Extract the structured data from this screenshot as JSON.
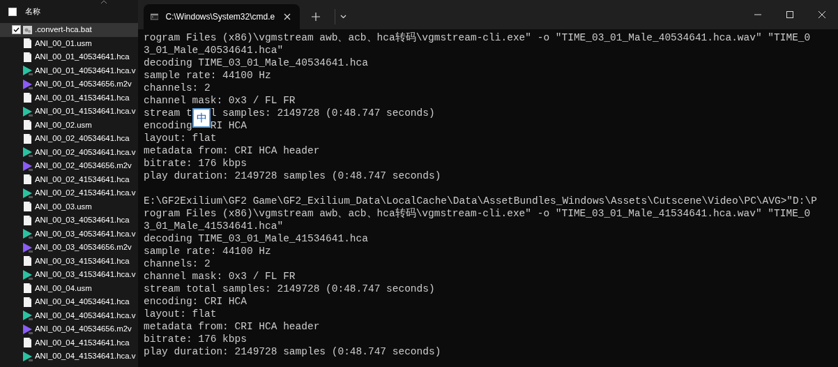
{
  "explorer": {
    "header": {
      "label": "名称",
      "checked": false
    },
    "items": [
      {
        "name": ".convert-hca.bat",
        "kind": "script",
        "selected": true,
        "checked": true
      },
      {
        "name": "ANI_00_01.usm",
        "kind": "file",
        "selected": false,
        "checked": false
      },
      {
        "name": "ANI_00_01_40534641.hca",
        "kind": "file",
        "selected": false,
        "checked": false
      },
      {
        "name": "ANI_00_01_40534641.hca.v",
        "kind": "audio",
        "selected": false,
        "checked": false
      },
      {
        "name": "ANI_00_01_40534656.m2v",
        "kind": "video",
        "selected": false,
        "checked": false
      },
      {
        "name": "ANI_00_01_41534641.hca",
        "kind": "file",
        "selected": false,
        "checked": false
      },
      {
        "name": "ANI_00_01_41534641.hca.v",
        "kind": "audio",
        "selected": false,
        "checked": false
      },
      {
        "name": "ANI_00_02.usm",
        "kind": "file",
        "selected": false,
        "checked": false
      },
      {
        "name": "ANI_00_02_40534641.hca",
        "kind": "file",
        "selected": false,
        "checked": false
      },
      {
        "name": "ANI_00_02_40534641.hca.v",
        "kind": "audio",
        "selected": false,
        "checked": false
      },
      {
        "name": "ANI_00_02_40534656.m2v",
        "kind": "video",
        "selected": false,
        "checked": false
      },
      {
        "name": "ANI_00_02_41534641.hca",
        "kind": "file",
        "selected": false,
        "checked": false
      },
      {
        "name": "ANI_00_02_41534641.hca.v",
        "kind": "audio",
        "selected": false,
        "checked": false
      },
      {
        "name": "ANI_00_03.usm",
        "kind": "file",
        "selected": false,
        "checked": false
      },
      {
        "name": "ANI_00_03_40534641.hca",
        "kind": "file",
        "selected": false,
        "checked": false
      },
      {
        "name": "ANI_00_03_40534641.hca.v",
        "kind": "audio",
        "selected": false,
        "checked": false
      },
      {
        "name": "ANI_00_03_40534656.m2v",
        "kind": "video",
        "selected": false,
        "checked": false
      },
      {
        "name": "ANI_00_03_41534641.hca",
        "kind": "file",
        "selected": false,
        "checked": false
      },
      {
        "name": "ANI_00_03_41534641.hca.v",
        "kind": "audio",
        "selected": false,
        "checked": false
      },
      {
        "name": "ANI_00_04.usm",
        "kind": "file",
        "selected": false,
        "checked": false
      },
      {
        "name": "ANI_00_04_40534641.hca",
        "kind": "file",
        "selected": false,
        "checked": false
      },
      {
        "name": "ANI_00_04_40534641.hca.v",
        "kind": "audio",
        "selected": false,
        "checked": false
      },
      {
        "name": "ANI_00_04_40534656.m2v",
        "kind": "video",
        "selected": false,
        "checked": false
      },
      {
        "name": "ANI_00_04_41534641.hca",
        "kind": "file",
        "selected": false,
        "checked": false
      },
      {
        "name": "ANI_00_04_41534641.hca.v",
        "kind": "audio",
        "selected": false,
        "checked": false
      }
    ]
  },
  "terminal": {
    "tab": {
      "title": "C:\\Windows\\System32\\cmd.e",
      "selected": true
    },
    "ime_indicator": "中",
    "blocks": [
      [
        {
          "kind": "text",
          "text": "rogram Files (x86)\\vgmstream awb、acb、hca转码\\vgmstream-cli.exe\" -o \"TIME_03_01_Male_40534641.hca.wav\" \"TIME_0"
        },
        {
          "kind": "text",
          "text": "3_01_Male_40534641.hca\""
        },
        {
          "kind": "text",
          "text": "decoding TIME_03_01_Male_40534641.hca"
        },
        {
          "kind": "text",
          "text": "sample rate: 44100 Hz"
        },
        {
          "kind": "text",
          "text": "channels: 2"
        },
        {
          "kind": "text",
          "text": "channel mask: 0x3 / FL FR"
        },
        {
          "kind": "covered",
          "parts": [
            "stream t",
            "l samples: 2149728 (0:48.747 seconds)"
          ]
        },
        {
          "kind": "covered",
          "parts": [
            "encoding",
            "RI HCA"
          ]
        },
        {
          "kind": "text",
          "text": "layout: flat"
        },
        {
          "kind": "text",
          "text": "metadata from: CRI HCA header"
        },
        {
          "kind": "text",
          "text": "bitrate: 176 kbps"
        },
        {
          "kind": "text",
          "text": "play duration: 2149728 samples (0:48.747 seconds)"
        }
      ],
      [
        {
          "kind": "text",
          "text": "E:\\GF2Exilium\\GF2 Game\\GF2_Exilium_Data\\LocalCache\\Data\\AssetBundles_Windows\\Assets\\Cutscene\\Video\\PC\\AVG>\"D:\\P"
        },
        {
          "kind": "text",
          "text": "rogram Files (x86)\\vgmstream awb、acb、hca转码\\vgmstream-cli.exe\" -o \"TIME_03_01_Male_41534641.hca.wav\" \"TIME_0"
        },
        {
          "kind": "text",
          "text": "3_01_Male_41534641.hca\""
        },
        {
          "kind": "text",
          "text": "decoding TIME_03_01_Male_41534641.hca"
        },
        {
          "kind": "text",
          "text": "sample rate: 44100 Hz"
        },
        {
          "kind": "text",
          "text": "channels: 2"
        },
        {
          "kind": "text",
          "text": "channel mask: 0x3 / FL FR"
        },
        {
          "kind": "text",
          "text": "stream total samples: 2149728 (0:48.747 seconds)"
        },
        {
          "kind": "text",
          "text": "encoding: CRI HCA"
        },
        {
          "kind": "text",
          "text": "layout: flat"
        },
        {
          "kind": "text",
          "text": "metadata from: CRI HCA header"
        },
        {
          "kind": "text",
          "text": "bitrate: 176 kbps"
        },
        {
          "kind": "text",
          "text": "play duration: 2149728 samples (0:48.747 seconds)"
        }
      ]
    ]
  }
}
